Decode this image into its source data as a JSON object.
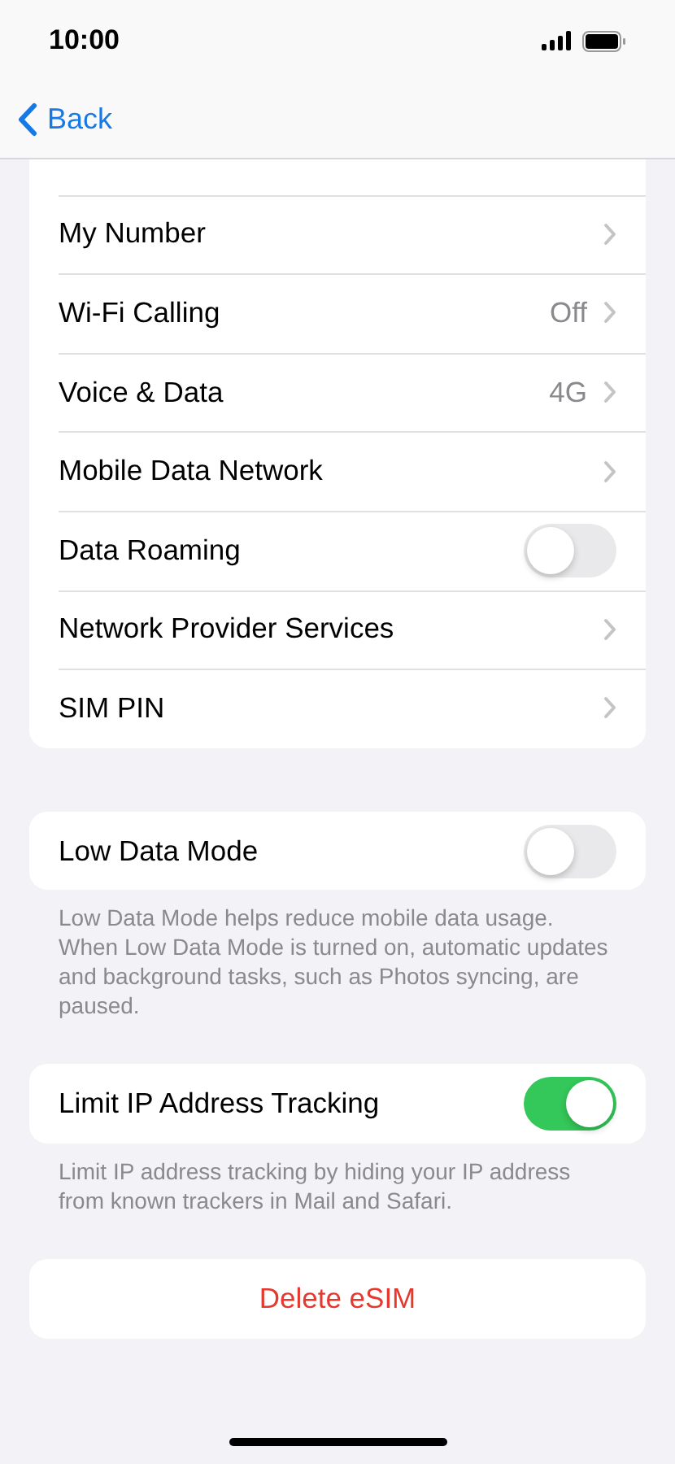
{
  "status_bar": {
    "time": "10:00"
  },
  "nav": {
    "back": "Back"
  },
  "groups": [
    {
      "rows": [
        {
          "kind": "link",
          "label": "My Number"
        },
        {
          "kind": "link",
          "label": "Wi-Fi Calling",
          "value": "Off"
        },
        {
          "kind": "link",
          "label": "Voice & Data",
          "value": "4G"
        },
        {
          "kind": "link",
          "label": "Mobile Data Network"
        },
        {
          "kind": "toggle",
          "label": "Data Roaming",
          "on": false
        },
        {
          "kind": "link",
          "label": "Network Provider Services"
        },
        {
          "kind": "link",
          "label": "SIM PIN"
        }
      ]
    },
    {
      "rows": [
        {
          "kind": "toggle",
          "label": "Low Data Mode",
          "on": false
        }
      ],
      "footer": "Low Data Mode helps reduce mobile data usage. When Low Data Mode is turned on, automatic updates and background tasks, such as Photos syncing, are paused."
    },
    {
      "rows": [
        {
          "kind": "toggle",
          "label": "Limit IP Address Tracking",
          "on": true
        }
      ],
      "footer": "Limit IP address tracking by hiding your IP address from known trackers in Mail and Safari."
    },
    {
      "rows": [
        {
          "kind": "destructive",
          "label": "Delete eSIM"
        }
      ]
    }
  ]
}
